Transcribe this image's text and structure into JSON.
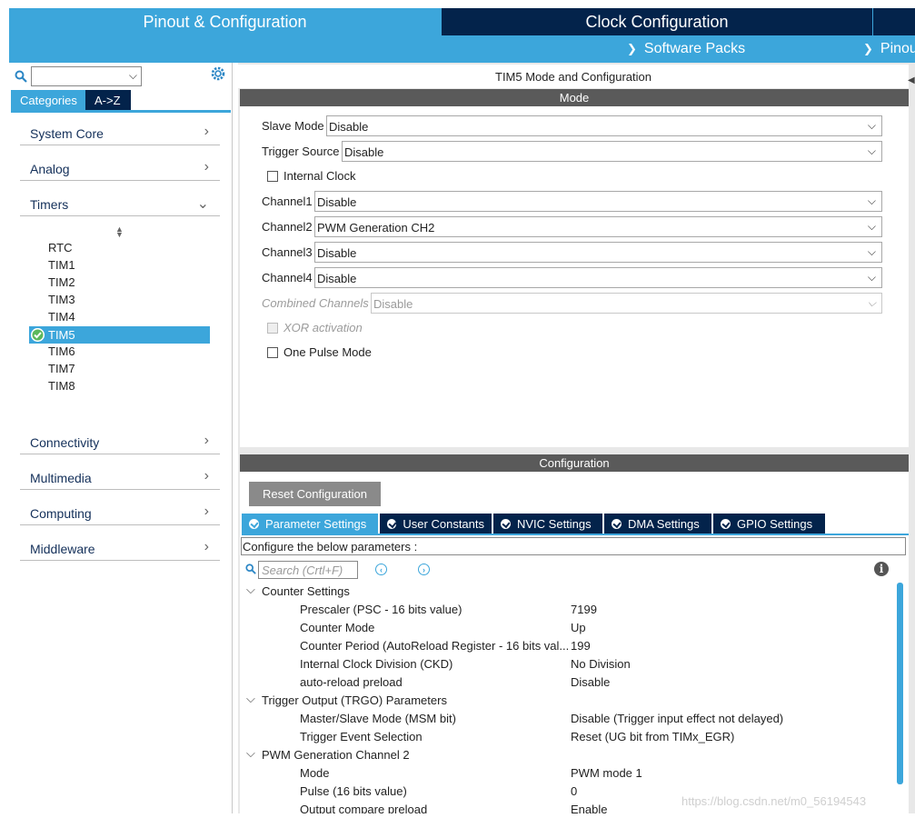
{
  "topbar": {
    "pinout_tab": "Pinout & Configuration",
    "clock_tab": "Clock Configuration",
    "software_packs": "Software Packs",
    "pinout_menu": "Pinout"
  },
  "sidebar": {
    "search_value": "",
    "tabs": [
      "Categories",
      "A->Z"
    ],
    "categories": [
      {
        "label": "System Core",
        "arrow": "›"
      },
      {
        "label": "Analog",
        "arrow": "›"
      },
      {
        "label": "Timers",
        "arrow": "⌄"
      },
      {
        "label": "Connectivity",
        "arrow": "›"
      },
      {
        "label": "Multimedia",
        "arrow": "›"
      },
      {
        "label": "Computing",
        "arrow": "›"
      },
      {
        "label": "Middleware",
        "arrow": "›"
      }
    ],
    "timers": [
      "RTC",
      "TIM1",
      "TIM2",
      "TIM3",
      "TIM4",
      "TIM5",
      "TIM6",
      "TIM7",
      "TIM8"
    ],
    "selected_timer": "TIM5"
  },
  "mode": {
    "title": "TIM5 Mode and Configuration",
    "header": "Mode",
    "slave_mode": {
      "label": "Slave Mode",
      "value": "Disable"
    },
    "trigger_source": {
      "label": "Trigger Source",
      "value": "Disable"
    },
    "internal_clock": {
      "label": "Internal Clock",
      "checked": false
    },
    "channel1": {
      "label": "Channel1",
      "value": "Disable"
    },
    "channel2": {
      "label": "Channel2",
      "value": "PWM Generation CH2"
    },
    "channel3": {
      "label": "Channel3",
      "value": "Disable"
    },
    "channel4": {
      "label": "Channel4",
      "value": "Disable"
    },
    "combined_channels": {
      "label": "Combined Channels",
      "value": "Disable"
    },
    "xor_activation": {
      "label": "XOR activation",
      "checked": false
    },
    "one_pulse_mode": {
      "label": "One Pulse Mode",
      "checked": false
    }
  },
  "configuration": {
    "header": "Configuration",
    "reset_button": "Reset Configuration",
    "tabs": [
      "Parameter Settings",
      "User Constants",
      "NVIC Settings",
      "DMA Settings",
      "GPIO Settings"
    ],
    "description": "Configure the below parameters :",
    "search_placeholder": "Search (Crtl+F)",
    "groups": {
      "counter": {
        "title": "Counter Settings",
        "params": [
          {
            "name": "Prescaler (PSC - 16 bits value)",
            "value": "7199"
          },
          {
            "name": "Counter Mode",
            "value": "Up"
          },
          {
            "name": "Counter Period (AutoReload Register - 16 bits val...",
            "value": "199"
          },
          {
            "name": "Internal Clock Division (CKD)",
            "value": "No Division"
          },
          {
            "name": "auto-reload preload",
            "value": "Disable"
          }
        ]
      },
      "trgo": {
        "title": "Trigger Output (TRGO) Parameters",
        "params": [
          {
            "name": "Master/Slave Mode (MSM bit)",
            "value": "Disable (Trigger input effect not delayed)"
          },
          {
            "name": "Trigger Event Selection",
            "value": "Reset (UG bit from TIMx_EGR)"
          }
        ]
      },
      "pwm2": {
        "title": "PWM Generation Channel 2",
        "params": [
          {
            "name": "Mode",
            "value": "PWM mode 1"
          },
          {
            "name": "Pulse (16 bits value)",
            "value": "0"
          },
          {
            "name": "Output compare preload",
            "value": "Enable"
          }
        ]
      }
    }
  },
  "watermark": "https://blog.csdn.net/m0_56194543",
  "colors": {
    "accent": "#3ca6db",
    "navy": "#03234b",
    "header_gray": "#5a5a5a"
  }
}
